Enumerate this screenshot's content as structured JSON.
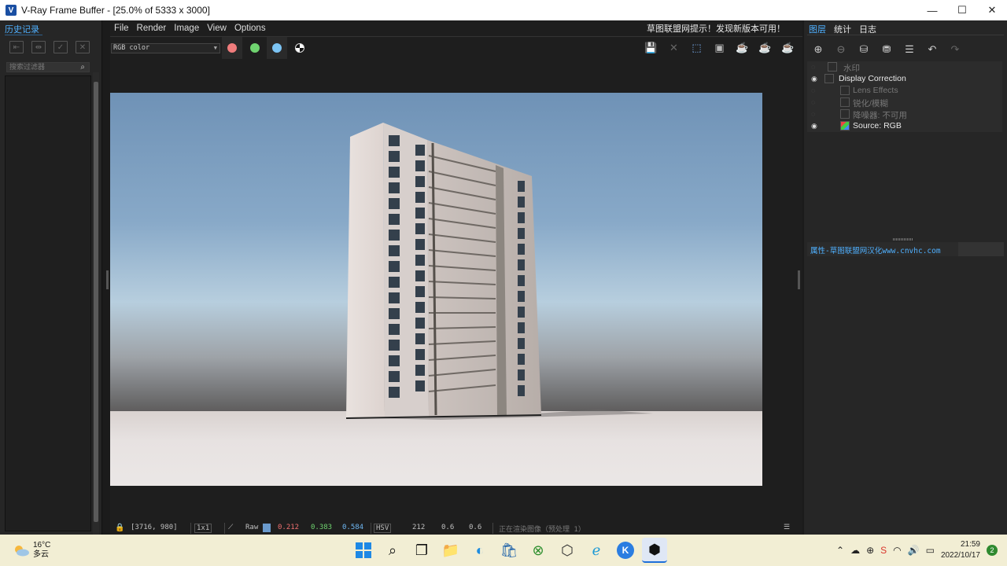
{
  "window": {
    "title": "V-Ray Frame Buffer - [25.0% of 5333 x 3000]",
    "app_icon": "V",
    "minimize": "—",
    "maximize": "☐",
    "close": "✕"
  },
  "left_panel": {
    "tab": "历史记录",
    "search_placeholder": "搜索过滤器"
  },
  "menu": [
    "File",
    "Render",
    "Image",
    "View",
    "Options"
  ],
  "notice": "草图联盟网提示！发现新版本可用！",
  "channel": "RGB color",
  "channel_dots": {
    "red": "#f07c7c",
    "green": "#6fd36f",
    "blue": "#7cc4f4"
  },
  "right_panel": {
    "tabs": [
      "图层",
      "统计",
      "日志"
    ],
    "layers": [
      {
        "label": "水印",
        "visible": false,
        "indent": 1
      },
      {
        "label": "Display Correction",
        "visible": true,
        "indent": 0
      },
      {
        "label": "Lens Effects",
        "visible": false,
        "indent": 1
      },
      {
        "label": "锐化/模糊",
        "visible": false,
        "indent": 1
      },
      {
        "label": "降噪器: 不可用",
        "visible": false,
        "indent": 1
      },
      {
        "label": "Source: RGB",
        "visible": true,
        "indent": 1
      }
    ],
    "properties_label": "属性-草图联盟网汉化www.cnvhc.com"
  },
  "status": {
    "coords": "[3716, 980]",
    "zoom": "1x1",
    "mode": "Raw",
    "r": "0.212",
    "g": "0.383",
    "b": "0.584",
    "color_space": "HSV",
    "h": "212",
    "s": "0.6",
    "v": "0.6",
    "progress_text": "正在渲染图像（预处理 1）"
  },
  "taskbar": {
    "temperature": "16°C",
    "weather": "多云",
    "time": "21:59",
    "date": "2022/10/17",
    "notifications": "2"
  }
}
